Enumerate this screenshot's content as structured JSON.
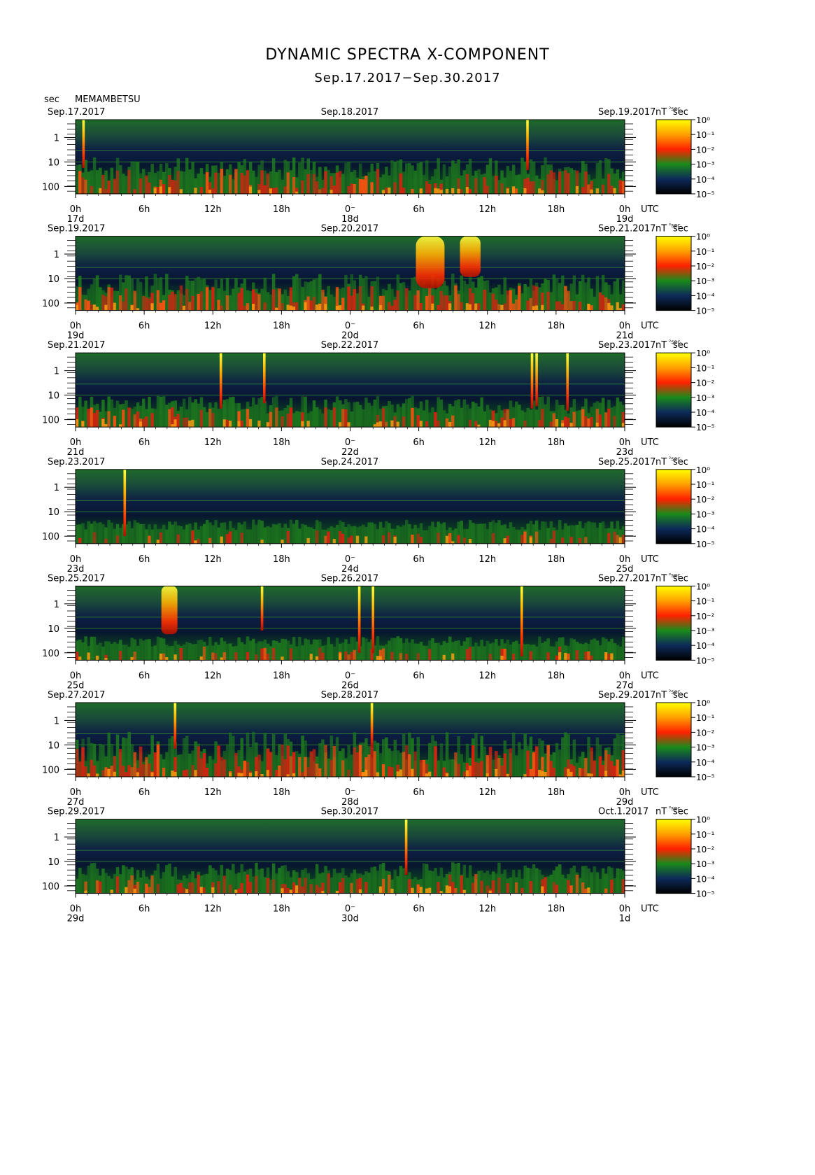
{
  "header": {
    "title": "DYNAMIC SPECTRA X-COMPONENT",
    "subtitle": "Sep.17.2017−Sep.30.2017",
    "y_unit": "sec",
    "station": "MEMAMBETSU"
  },
  "chart_data": {
    "type": "heatmap",
    "title": "DYNAMIC SPECTRA X-COMPONENT",
    "subtitle": "Sep.17.2017−Sep.30.2017",
    "ylabel": "sec",
    "ytick_labels": [
      "1",
      "10",
      "100"
    ],
    "yscale": "log",
    "xtick_labels": [
      "0h",
      "6h",
      "12h",
      "18h",
      "0⁻",
      "6h",
      "12h",
      "18h",
      "0h"
    ],
    "utc_label": "UTC",
    "colorbar": {
      "unit_label": "nT ²sec",
      "labels": [
        "10⁰",
        "10⁻¹",
        "10⁻²",
        "10⁻³",
        "10⁻⁴",
        "10⁻⁵"
      ],
      "colors": [
        "#ffff00",
        "#ffa000",
        "#ff2000",
        "#1a8a1a",
        "#0d2a5a",
        "#000000"
      ]
    },
    "panels": [
      {
        "left_date": "Sep.17.2017",
        "mid_date": "Sep.18.2017",
        "right_date": "Sep.19.2017",
        "day_labels": [
          "17d",
          "18d",
          "19d"
        ],
        "background_level": "high",
        "spikes": [
          {
            "t": 0.7,
            "top": 0.0,
            "bottom": 0.65
          },
          {
            "t": 39.5,
            "top": 0.0,
            "bottom": 0.68
          }
        ]
      },
      {
        "left_date": "Sep.19.2017",
        "mid_date": "Sep.20.2017",
        "right_date": "Sep.21.2017",
        "day_labels": [
          "19d",
          "20d",
          "21d"
        ],
        "background_level": "high",
        "bursts": [
          {
            "t": 31.0,
            "width": 2.5,
            "top": 0.0,
            "bottom": 0.7
          },
          {
            "t": 34.5,
            "width": 1.8,
            "top": 0.0,
            "bottom": 0.55
          }
        ]
      },
      {
        "left_date": "Sep.21.2017",
        "mid_date": "Sep.22.2017",
        "right_date": "Sep.23.2017",
        "day_labels": [
          "21d",
          "22d",
          "23d"
        ],
        "background_level": "medium",
        "spikes": [
          {
            "t": 12.7,
            "top": 0.0,
            "bottom": 0.75
          },
          {
            "t": 16.5,
            "top": 0.0,
            "bottom": 0.68
          },
          {
            "t": 39.9,
            "top": 0.0,
            "bottom": 0.75
          },
          {
            "t": 40.3,
            "top": 0.0,
            "bottom": 0.72
          },
          {
            "t": 43.0,
            "top": 0.0,
            "bottom": 0.78
          }
        ]
      },
      {
        "left_date": "Sep.23.2017",
        "mid_date": "Sep.24.2017",
        "right_date": "Sep.25.2017",
        "day_labels": [
          "23d",
          "24d",
          "25d"
        ],
        "background_level": "low",
        "spikes": [
          {
            "t": 4.3,
            "top": 0.0,
            "bottom": 0.9
          }
        ]
      },
      {
        "left_date": "Sep.25.2017",
        "mid_date": "Sep.26.2017",
        "right_date": "Sep.27.2017",
        "day_labels": [
          "25d",
          "26d",
          "27d"
        ],
        "background_level": "low",
        "bursts": [
          {
            "t": 8.2,
            "width": 1.4,
            "top": 0.0,
            "bottom": 0.65
          }
        ],
        "spikes": [
          {
            "t": 16.3,
            "top": 0.0,
            "bottom": 0.6
          },
          {
            "t": 24.8,
            "top": 0.0,
            "bottom": 0.9
          },
          {
            "t": 26.0,
            "top": 0.0,
            "bottom": 0.9
          },
          {
            "t": 39.0,
            "top": 0.0,
            "bottom": 0.95
          }
        ]
      },
      {
        "left_date": "Sep.27.2017",
        "mid_date": "Sep.28.2017",
        "right_date": "Sep.29.2017",
        "day_labels": [
          "27d",
          "28d",
          "29d"
        ],
        "background_level": "very-high",
        "spikes": [
          {
            "t": 8.7,
            "top": 0.0,
            "bottom": 0.62
          },
          {
            "t": 25.9,
            "top": 0.0,
            "bottom": 0.6
          }
        ]
      },
      {
        "left_date": "Sep.29.2017",
        "mid_date": "Sep.30.2017",
        "right_date": "Oct.1.2017",
        "day_labels": [
          "29d",
          "30d",
          "1d"
        ],
        "background_level": "medium",
        "spikes": [
          {
            "t": 28.9,
            "top": 0.0,
            "bottom": 0.75
          }
        ]
      }
    ]
  }
}
